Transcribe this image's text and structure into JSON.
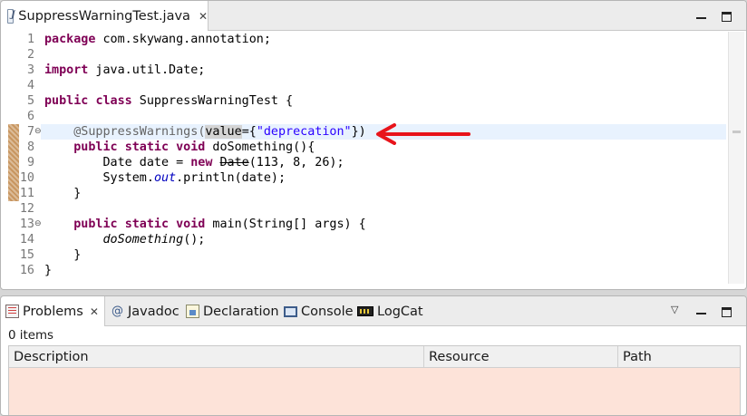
{
  "editor": {
    "tab": {
      "title": "SuppressWarningTest.java",
      "close_glyph": "✕",
      "icon": "java-file-icon"
    },
    "line_numbers": [
      "1",
      "2",
      "3",
      "4",
      "5",
      "6",
      "7",
      "8",
      "9",
      "10",
      "11",
      "12",
      "13",
      "14",
      "15",
      "16"
    ],
    "fold_markers": [
      {
        "line": 7,
        "glyph": "⊖"
      },
      {
        "line": 13,
        "glyph": "⊖"
      }
    ],
    "current_line": 7,
    "overview_ruler_marks": [
      {
        "from_line": 7,
        "to_line": 11,
        "color": "#c89660"
      }
    ],
    "code": {
      "l1": {
        "kw": "package",
        "rest": " com.skywang.annotation;"
      },
      "l3": {
        "kw": "import",
        "rest": " java.util.Date;"
      },
      "l5": {
        "kw1": "public",
        "kw2": "class",
        "rest": " SuppressWarningTest {"
      },
      "l7": {
        "indent": "    ",
        "ann": "@SuppressWarnings",
        "paren": "(",
        "param": "value",
        "eq": "={",
        "str": "\"deprecation\"",
        "end": "})"
      },
      "l8": {
        "indent": "    ",
        "kw1": "public",
        "kw2": "static",
        "kw3": "void",
        "rest": " doSomething(){"
      },
      "l9": {
        "indent": "        ",
        "pre": "Date date = ",
        "kw": "new",
        "dep": "Date",
        "rest": "(113, 8, 26);"
      },
      "l10": {
        "indent": "        ",
        "pre": "System.",
        "field": "out",
        "rest": ".println(date);"
      },
      "l11": {
        "text": "    }"
      },
      "l13": {
        "indent": "    ",
        "kw1": "public",
        "kw2": "static",
        "kw3": "void",
        "rest": " main(String[] args) {"
      },
      "l14": {
        "indent": "        ",
        "call": "doSomething",
        "rest": "();"
      },
      "l15": {
        "text": "    }"
      },
      "l16": {
        "text": "}"
      }
    },
    "arrow_annotation": {
      "color": "#e8141b",
      "points_to_line": 7
    }
  },
  "bottom_panel": {
    "tabs": [
      {
        "label": "Problems",
        "icon": "problems-icon",
        "active": true,
        "close_glyph": "✕"
      },
      {
        "label": "Javadoc",
        "icon": "javadoc-icon",
        "glyph": "@"
      },
      {
        "label": "Declaration",
        "icon": "declaration-icon"
      },
      {
        "label": "Console",
        "icon": "console-icon"
      },
      {
        "label": "LogCat",
        "icon": "logcat-icon"
      }
    ],
    "view_menu_glyph": "▽",
    "items_count": "0 items",
    "columns": [
      "Description",
      "Resource",
      "Path"
    ],
    "rows": [],
    "body_color": "#fde3d9"
  }
}
